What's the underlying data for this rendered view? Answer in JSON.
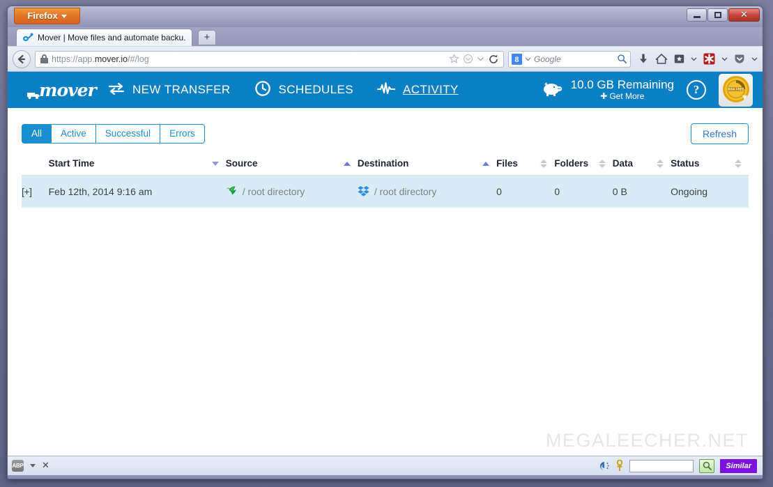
{
  "browser": {
    "firefox_button": "Firefox",
    "tab_title": "Mover | Move files and automate backu...",
    "new_tab_label": "+",
    "url": "https://app.mover.io/#/log",
    "url_prefix": "https://app.",
    "url_domain": "mover.io",
    "url_suffix": "/#/log",
    "search_placeholder": "Google",
    "search_engine": "8",
    "window_controls": {
      "minimize": "_",
      "restore": "❐",
      "close": "✕"
    }
  },
  "app": {
    "logo_text": "mover",
    "nav": [
      {
        "label": "NEW TRANSFER",
        "icon": "transfer-arrows-icon",
        "active": false
      },
      {
        "label": "SCHEDULES",
        "icon": "clock-icon",
        "active": false
      },
      {
        "label": "ACTIVITY",
        "icon": "activity-pulse-icon",
        "active": true
      }
    ],
    "quota": {
      "amount": "10.0 GB Remaining",
      "get_more": "Get More",
      "plus": "✚",
      "icon": "piggy-bank-icon"
    },
    "help_label": "?",
    "badge_text": "RISK FREE"
  },
  "filters": {
    "items": [
      {
        "label": "All",
        "active": true
      },
      {
        "label": "Active",
        "active": false
      },
      {
        "label": "Successful",
        "active": false
      },
      {
        "label": "Errors",
        "active": false
      }
    ],
    "refresh_label": "Refresh"
  },
  "table": {
    "columns": [
      {
        "label": "Start Time",
        "sort": "desc"
      },
      {
        "label": "Source",
        "sort": "asc"
      },
      {
        "label": "Destination",
        "sort": "asc"
      },
      {
        "label": "Files",
        "sort": "none"
      },
      {
        "label": "Folders",
        "sort": "none"
      },
      {
        "label": "Data",
        "sort": "none"
      },
      {
        "label": "Status",
        "sort": "none"
      }
    ],
    "rows": [
      {
        "expander": "[+]",
        "start_time": "Feb 12th, 2014 9:16 am",
        "source_icon": "copy-bird-icon",
        "source": "/ root directory",
        "destination_icon": "dropbox-icon",
        "destination": "/ root directory",
        "files": "0",
        "folders": "0",
        "data": "0 B",
        "status": "Ongoing"
      }
    ]
  },
  "watermark": "MEGALEECHER.NET",
  "statusbar": {
    "abp_label": "ABP",
    "close_label": "✕",
    "find_value": "",
    "similar_label": "Similar"
  },
  "colors": {
    "brand_blue": "#0b7fc4",
    "accent_blue": "#1a8fd0",
    "row_bg": "#d8ecf5",
    "sort_active": "#6f79d4",
    "similar_purple": "#7b12e0"
  }
}
